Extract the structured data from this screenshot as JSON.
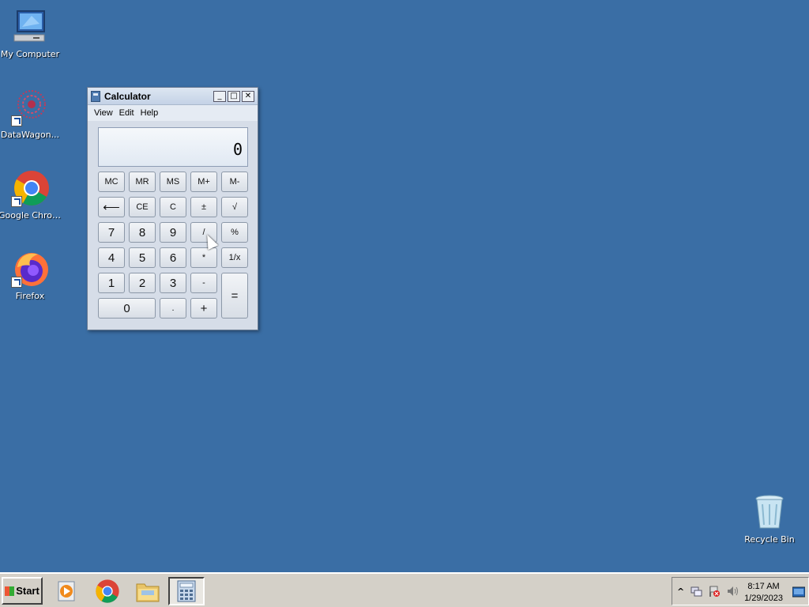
{
  "desktop": {
    "icons": [
      {
        "label": "My Computer"
      },
      {
        "label": "DataWagon..."
      },
      {
        "label": "Google Chrome"
      },
      {
        "label": "Firefox"
      },
      {
        "label": "Recycle Bin"
      }
    ]
  },
  "calculator": {
    "title": "Calculator",
    "window_buttons": {
      "minimize": "_",
      "maximize": "□",
      "close": "✕"
    },
    "menu": [
      "View",
      "Edit",
      "Help"
    ],
    "display_value": "0",
    "keys": {
      "mc": "MC",
      "mr": "MR",
      "ms": "MS",
      "mplus": "M+",
      "mminus": "M-",
      "backspace": "⟵",
      "ce": "CE",
      "c": "C",
      "plusminus": "±",
      "sqrt": "√",
      "seven": "7",
      "eight": "8",
      "nine": "9",
      "divide": "/",
      "percent": "%",
      "four": "4",
      "five": "5",
      "six": "6",
      "multiply": "*",
      "reciprocal": "1/x",
      "one": "1",
      "two": "2",
      "three": "3",
      "minus": "-",
      "equals": "=",
      "zero": "0",
      "decimal": ".",
      "plus": "+"
    }
  },
  "taskbar": {
    "start_label": "Start",
    "clock_time": "8:17 AM",
    "clock_date": "1/29/2023",
    "tray_expand": "^"
  }
}
